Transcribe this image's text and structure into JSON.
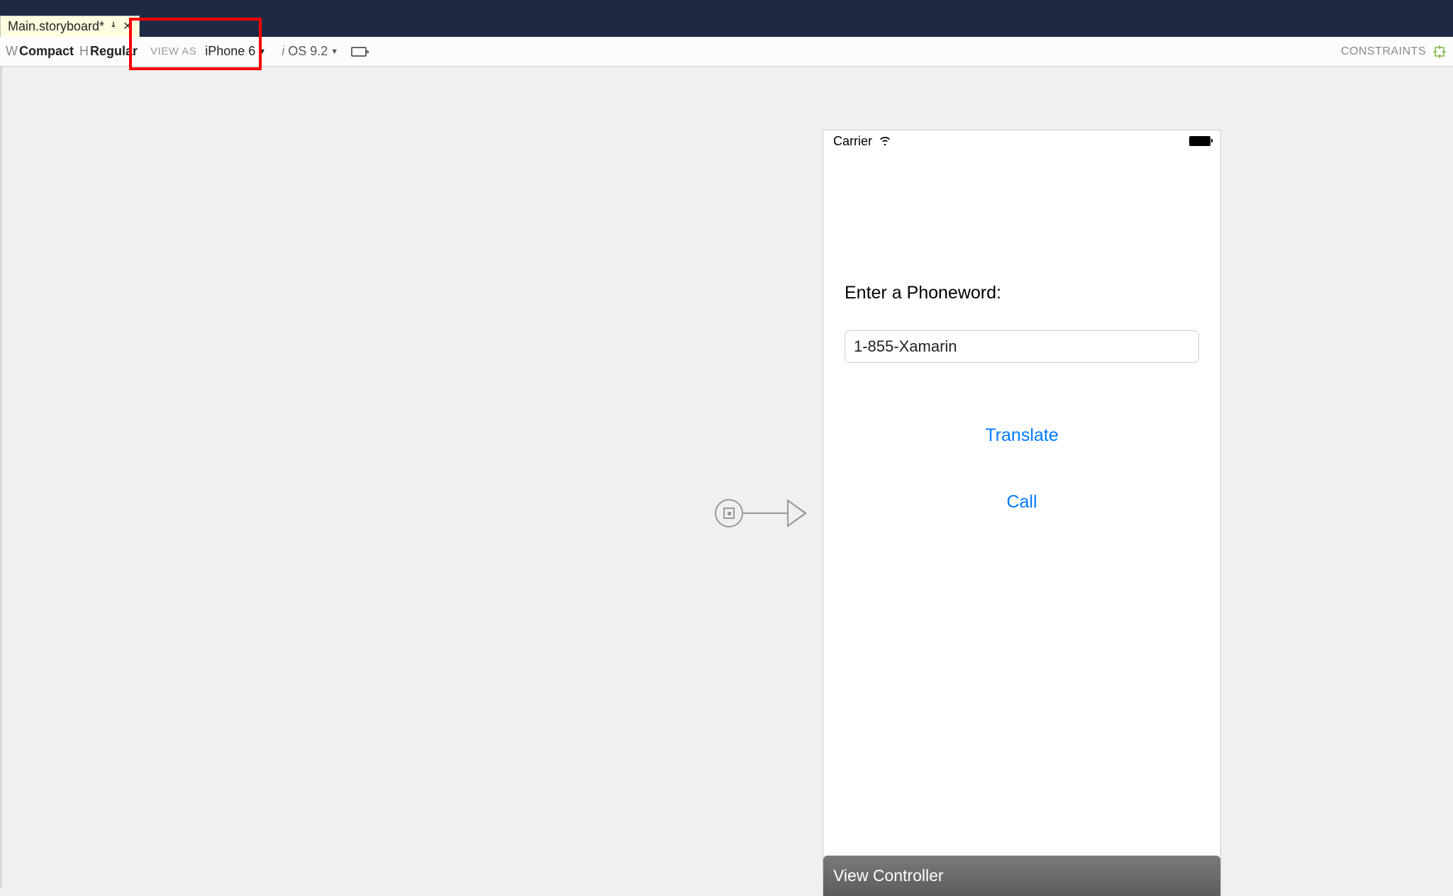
{
  "tab": {
    "title": "Main.storyboard*"
  },
  "toolbar": {
    "size_class_w_prefix": "W",
    "size_class_w": "Compact",
    "size_class_h_prefix": "H",
    "size_class_h": "Regular",
    "view_as_label": "VIEW AS",
    "device": "iPhone 6",
    "os_prefix": "i",
    "os_version": "OS 9.2",
    "constraints_label": "CONSTRAINTS"
  },
  "statusbar": {
    "carrier": "Carrier"
  },
  "app": {
    "label": "Enter a Phoneword:",
    "input_value": "1-855-Xamarin",
    "translate": "Translate",
    "call": "Call"
  },
  "bottom_bar": {
    "title": "View Controller"
  }
}
